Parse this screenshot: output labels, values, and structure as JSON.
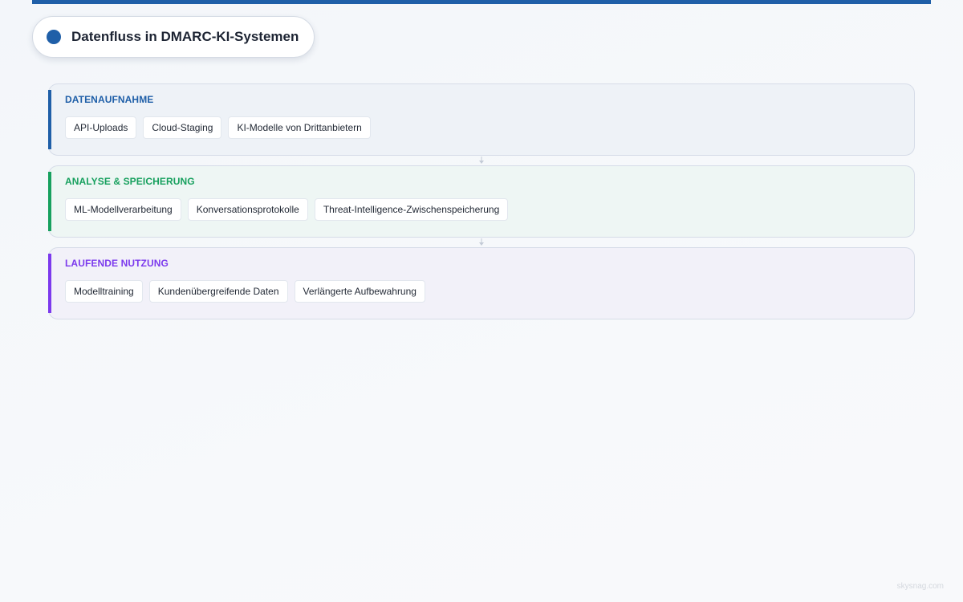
{
  "title": "Datenfluss in DMARC-KI-Systemen",
  "colors": {
    "brand": "#1f5fa8",
    "stage1": "#1f5fa8",
    "stage2": "#17a05e",
    "stage3": "#7c3aed"
  },
  "stages": [
    {
      "label": "DATENAUFNAHME",
      "items": [
        "API-Uploads",
        "Cloud-Staging",
        "KI-Modelle von Drittanbietern"
      ]
    },
    {
      "label": "ANALYSE & SPEICHERUNG",
      "items": [
        "ML-Modellverarbeitung",
        "Konversationsprotokolle",
        "Threat-Intelligence-Zwischenspeicherung"
      ]
    },
    {
      "label": "LAUFENDE NUTZUNG",
      "items": [
        "Modelltraining",
        "Kundenübergreifende Daten",
        "Verlängerte Aufbewahrung"
      ]
    }
  ],
  "watermark": "skysnag.com"
}
